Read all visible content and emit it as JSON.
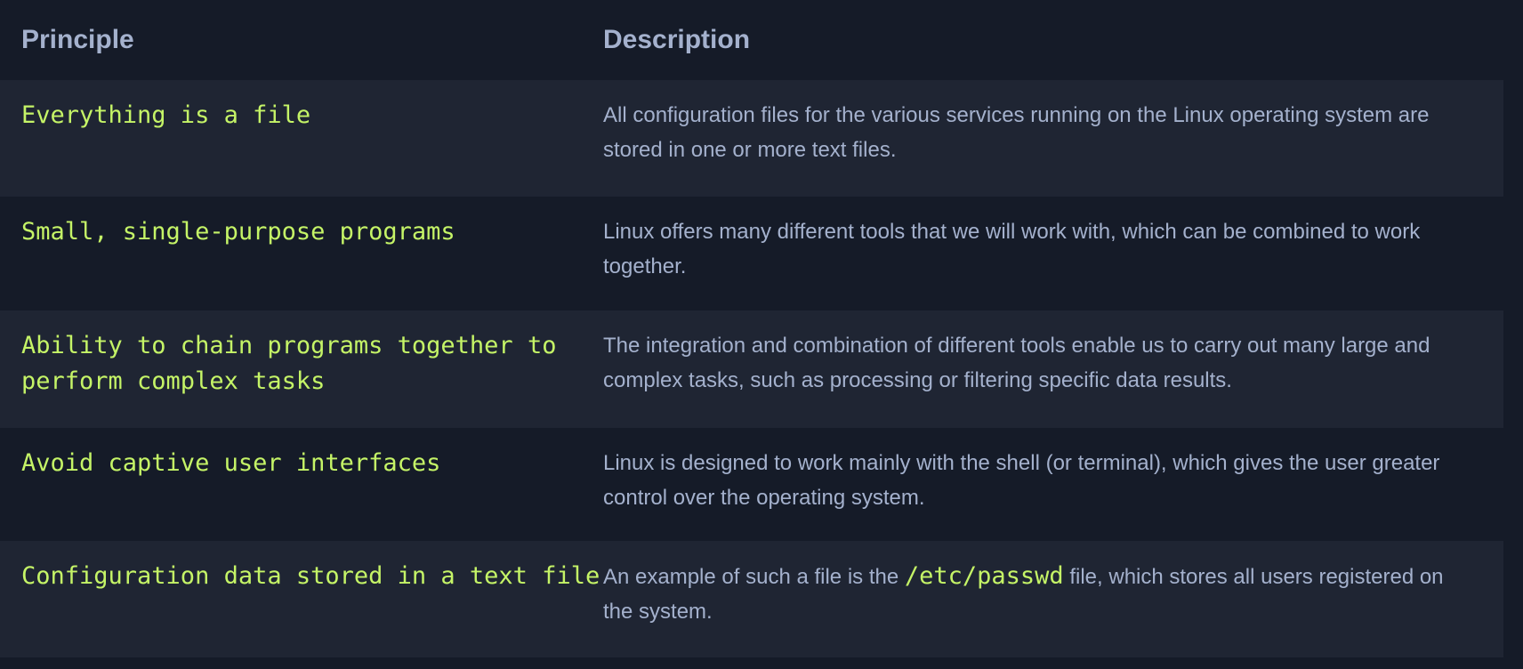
{
  "table": {
    "headers": {
      "principle": "Principle",
      "description": "Description"
    },
    "rows": [
      {
        "principle": "Everything is a file",
        "description": "All configuration files for the various services running on the Linux operating system are stored in one or more text files."
      },
      {
        "principle": "Small, single-purpose programs",
        "description": "Linux offers many different tools that we will work with, which can be combined to work together."
      },
      {
        "principle": "Ability to chain programs together to perform complex tasks",
        "description": "The integration and combination of different tools enable us to carry out many large and complex tasks, such as processing or filtering specific data results."
      },
      {
        "principle": "Avoid captive user interfaces",
        "description": "Linux is designed to work mainly with the shell (or terminal), which gives the user greater control over the operating system."
      },
      {
        "principle": "Configuration data stored in a text file",
        "description_before": "An example of such a file is the",
        "description_code": "/etc/passwd",
        "description_after": "file, which stores all users registered on the system."
      }
    ]
  },
  "colors": {
    "background": "#151b28",
    "row_alt": "#1f2533",
    "principle_text": "#c5f467",
    "description_text": "#a4b1cd"
  }
}
